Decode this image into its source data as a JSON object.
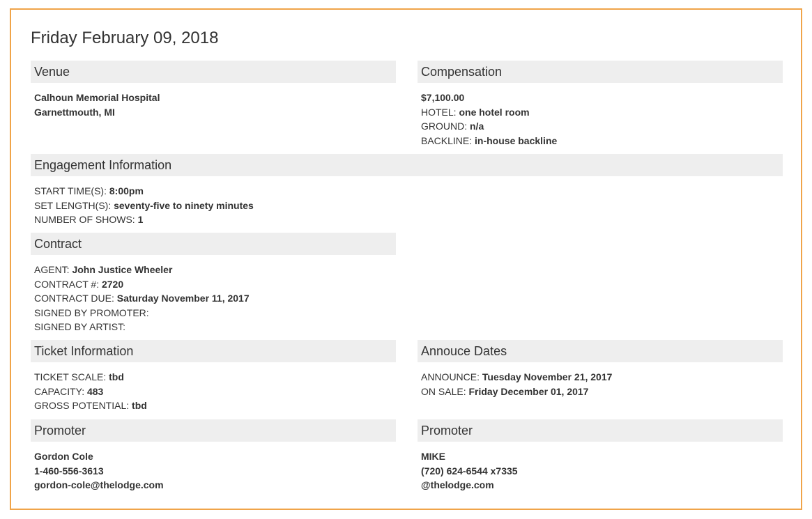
{
  "page": {
    "title": "Friday February 09, 2018"
  },
  "venue": {
    "header": "Venue",
    "name": "Calhoun Memorial Hospital",
    "location": "Garnettmouth, MI"
  },
  "compensation": {
    "header": "Compensation",
    "amount": "$7,100.00",
    "hotel_label": "HOTEL: ",
    "hotel_value": "one hotel room",
    "ground_label": "GROUND: ",
    "ground_value": "n/a",
    "backline_label": "BACKLINE: ",
    "backline_value": "in-house backline"
  },
  "engagement": {
    "header": "Engagement Information",
    "start_label": "START TIME(S): ",
    "start_value": "8:00pm",
    "set_label": "SET LENGTH(S): ",
    "set_value": "seventy-five to ninety minutes",
    "shows_label": "NUMBER OF SHOWS: ",
    "shows_value": "1"
  },
  "contract": {
    "header": "Contract",
    "agent_label": "AGENT: ",
    "agent_value": "John Justice Wheeler",
    "number_label": "CONTRACT #: ",
    "number_value": "2720",
    "due_label": "CONTRACT DUE: ",
    "due_value": "Saturday November 11, 2017",
    "signed_promoter_label": "SIGNED BY PROMOTER:",
    "signed_artist_label": "SIGNED BY ARTIST:"
  },
  "tickets": {
    "header": "Ticket Information",
    "scale_label": "TICKET SCALE: ",
    "scale_value": "tbd",
    "capacity_label": "CAPACITY: ",
    "capacity_value": "483",
    "gross_label": "GROSS POTENTIAL: ",
    "gross_value": "tbd"
  },
  "announce": {
    "header": "Annouce Dates",
    "announce_label": "ANNOUNCE: ",
    "announce_value": "Tuesday November 21, 2017",
    "onsale_label": "ON SALE: ",
    "onsale_value": "Friday December 01, 2017"
  },
  "promoter_left": {
    "header": "Promoter",
    "name": "Gordon Cole",
    "phone": "1-460-556-3613",
    "email": "gordon-cole@thelodge.com"
  },
  "promoter_right": {
    "header": "Promoter",
    "name": "MIKE",
    "phone": "(720) 624-6544 x7335",
    "email": "@thelodge.com"
  },
  "colors": {
    "border": "#f0a449",
    "header_bg": "#eeeeee",
    "text": "#333333"
  }
}
